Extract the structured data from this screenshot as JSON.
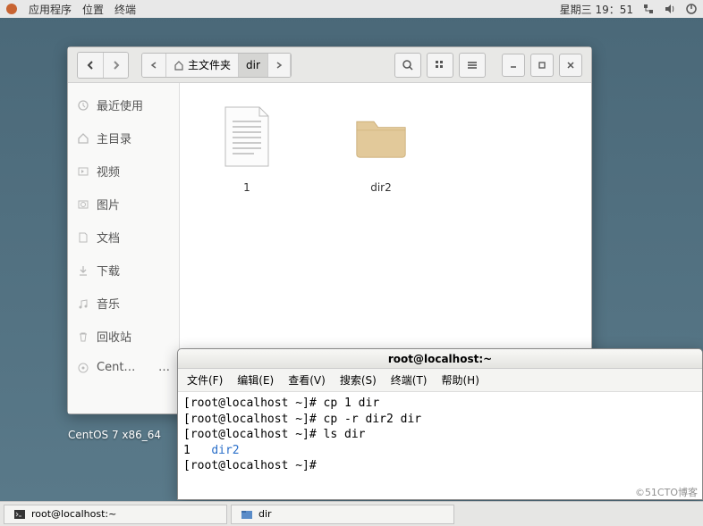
{
  "top_panel": {
    "menu_apps": "应用程序",
    "menu_places": "位置",
    "menu_terminal": "终端",
    "datetime": "星期三 19：51"
  },
  "nautilus": {
    "pathbar": {
      "home_label": "主文件夹",
      "current": "dir"
    },
    "sidebar": [
      "最近使用",
      "主目录",
      "视频",
      "图片",
      "文档",
      "下载",
      "音乐",
      "回收站",
      "Cent…"
    ],
    "files": {
      "item1": "1",
      "item2": "dir2"
    }
  },
  "terminal": {
    "title": "root@localhost:~",
    "menu": {
      "file": "文件(F)",
      "edit": "编辑(E)",
      "view": "查看(V)",
      "search": "搜索(S)",
      "terminal": "终端(T)",
      "help": "帮助(H)"
    },
    "lines": {
      "l1": "[root@localhost ~]# cp 1 dir",
      "l2": "[root@localhost ~]# cp -r dir2 dir",
      "l3": "[root@localhost ~]# ls dir",
      "l4_a": "1   ",
      "l4_dir": "dir2",
      "l5": "[root@localhost ~]# "
    }
  },
  "desktop_label": "CentOS 7 x86_64",
  "taskbar": {
    "item1": "root@localhost:~",
    "item2": "dir"
  },
  "watermark": "©51CTO博客"
}
